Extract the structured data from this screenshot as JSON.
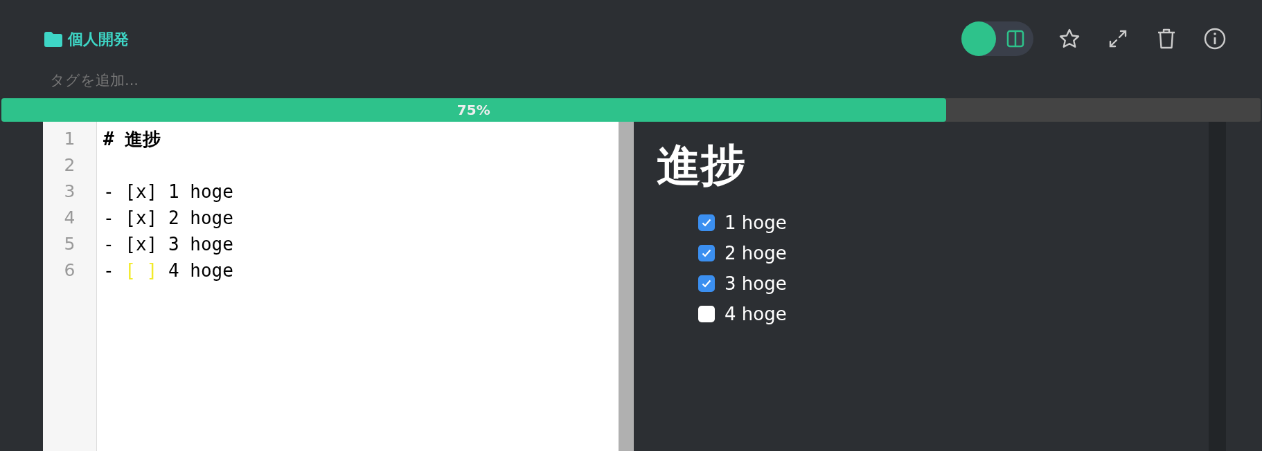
{
  "folder": {
    "name": "個人開発"
  },
  "tags": {
    "placeholder": "タグを追加..."
  },
  "toolbar": {
    "split_view": {
      "on": true
    }
  },
  "progress": {
    "level": 0.75,
    "label": "75%"
  },
  "editor": {
    "lines": [
      {
        "number": "1",
        "segments": [
          {
            "text": "# 進捗",
            "kind": "heading"
          }
        ]
      },
      {
        "number": "2"
      },
      {
        "number": "3",
        "segments": [
          {
            "text": "- [x] 1 hoge",
            "kind": "plain"
          }
        ]
      },
      {
        "number": "4",
        "segments": [
          {
            "text": "- [x] 2 hoge",
            "kind": "plain"
          }
        ]
      },
      {
        "number": "5",
        "segments": [
          {
            "text": "- [x] 3 hoge",
            "kind": "plain"
          }
        ]
      },
      {
        "number": "6",
        "segments": [
          {
            "text": "- ",
            "kind": "plain"
          },
          {
            "text": "[ ]",
            "kind": "highlight"
          },
          {
            "text": " 4 hoge",
            "kind": "plain"
          }
        ]
      }
    ]
  },
  "preview": {
    "heading": "進捗",
    "tasks": [
      {
        "label": "1 hoge",
        "checked": true
      },
      {
        "label": "2 hoge",
        "checked": true
      },
      {
        "label": "3 hoge",
        "checked": true
      },
      {
        "label": "4 hoge",
        "checked": false
      }
    ]
  }
}
